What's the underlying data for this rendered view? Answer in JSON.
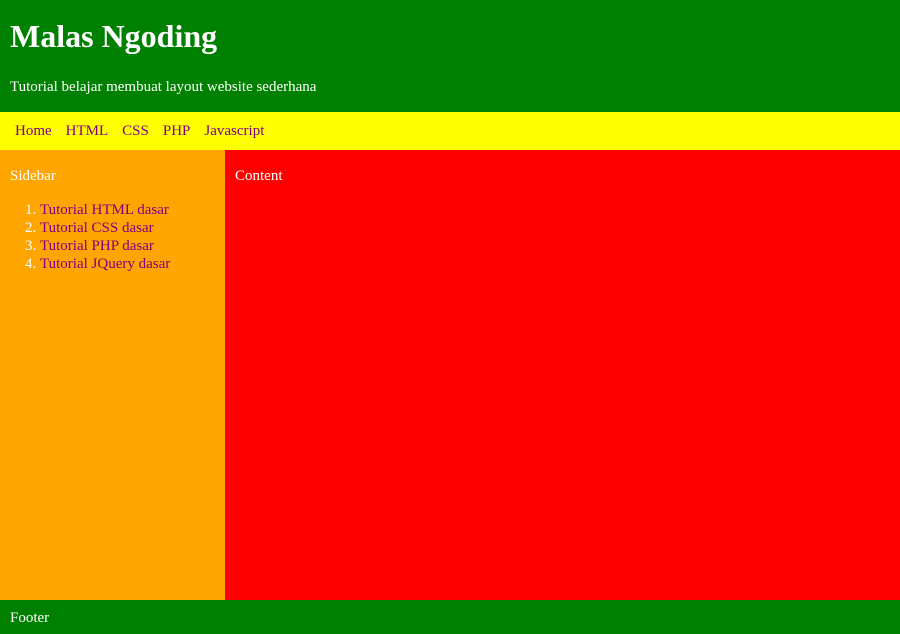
{
  "header": {
    "title": "Malas Ngoding",
    "tagline": "Tutorial belajar membuat layout website sederhana"
  },
  "nav": {
    "items": [
      {
        "label": "Home"
      },
      {
        "label": "HTML"
      },
      {
        "label": "CSS"
      },
      {
        "label": "PHP"
      },
      {
        "label": "Javascript"
      }
    ]
  },
  "sidebar": {
    "title": "Sidebar",
    "items": [
      {
        "label": "Tutorial HTML dasar"
      },
      {
        "label": "Tutorial CSS dasar"
      },
      {
        "label": "Tutorial PHP dasar"
      },
      {
        "label": "Tutorial JQuery dasar"
      }
    ]
  },
  "content": {
    "title": "Content"
  },
  "footer": {
    "text": "Footer"
  },
  "colors": {
    "header_bg": "#008000",
    "nav_bg": "#ffff00",
    "sidebar_bg": "#ffa500",
    "content_bg": "#ff0000",
    "footer_bg": "#008000",
    "link": "#800080",
    "text": "#ffffff"
  }
}
